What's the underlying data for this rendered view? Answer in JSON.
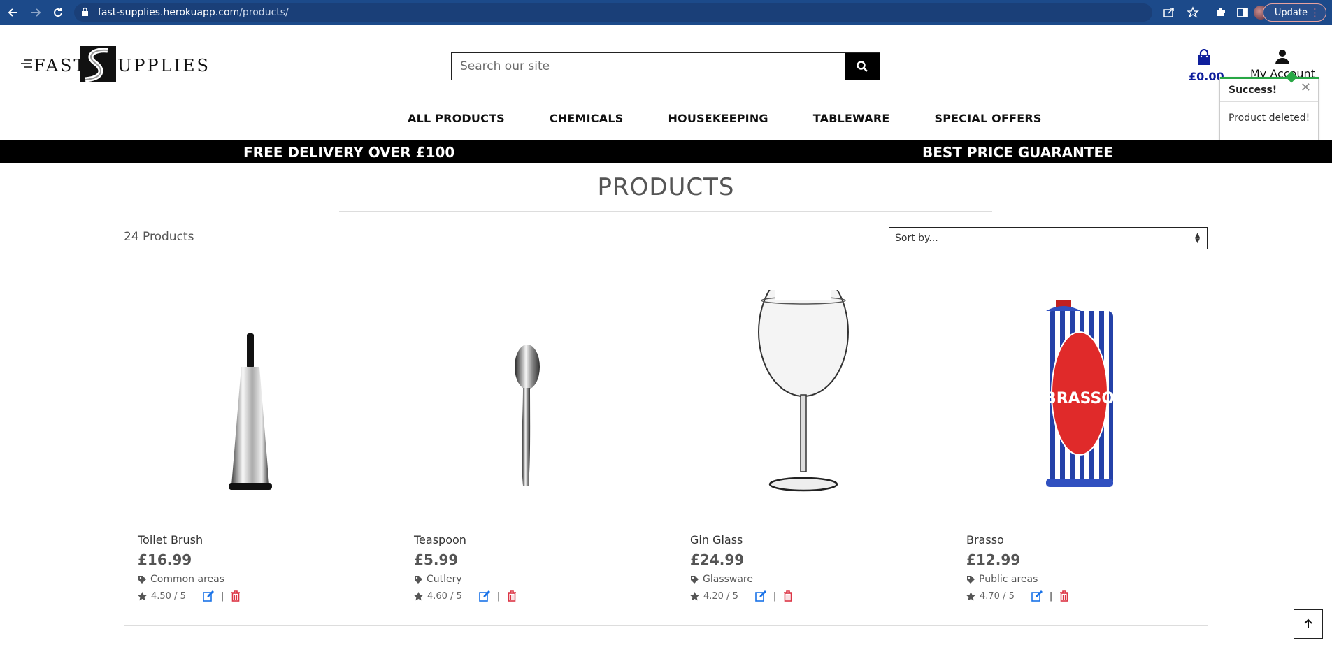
{
  "browser": {
    "url_host": "fast-supplies.herokuapp.com",
    "url_path": "/products/",
    "update_label": "Update"
  },
  "header": {
    "logo_left": "FAST",
    "logo_right": "UPPLIES",
    "search_placeholder": "Search our site",
    "bag_total": "£0.00",
    "account_label": "My Account"
  },
  "nav": {
    "items": [
      "ALL PRODUCTS",
      "CHEMICALS",
      "HOUSEKEEPING",
      "TABLEWARE",
      "SPECIAL OFFERS"
    ]
  },
  "banner": {
    "left": "FREE DELIVERY OVER £100",
    "right": "BEST PRICE GUARANTEE"
  },
  "toast": {
    "title": "Success!",
    "message": "Product deleted!"
  },
  "page": {
    "title": "PRODUCTS",
    "count": "24 Products",
    "sort_label": "Sort by..."
  },
  "products": [
    {
      "name": "Toilet Brush",
      "price": "£16.99",
      "category": "Common areas",
      "rating": "4.50 / 5",
      "image_icon": "toilet-brush-image"
    },
    {
      "name": "Teaspoon",
      "price": "£5.99",
      "category": "Cutlery",
      "rating": "4.60 / 5",
      "image_icon": "teaspoon-image"
    },
    {
      "name": "Gin Glass",
      "price": "£24.99",
      "category": "Glassware",
      "rating": "4.20 / 5",
      "image_icon": "gin-glass-image"
    },
    {
      "name": "Brasso",
      "price": "£12.99",
      "category": "Public areas",
      "rating": "4.70 / 5",
      "image_icon": "brasso-tin-image"
    }
  ],
  "colors": {
    "browser_bar": "#1c4a8a",
    "bag_blue": "#0f1f9c",
    "success_green": "#28a745",
    "edit_blue": "#1a73e8",
    "delete_red": "#dc3545"
  }
}
